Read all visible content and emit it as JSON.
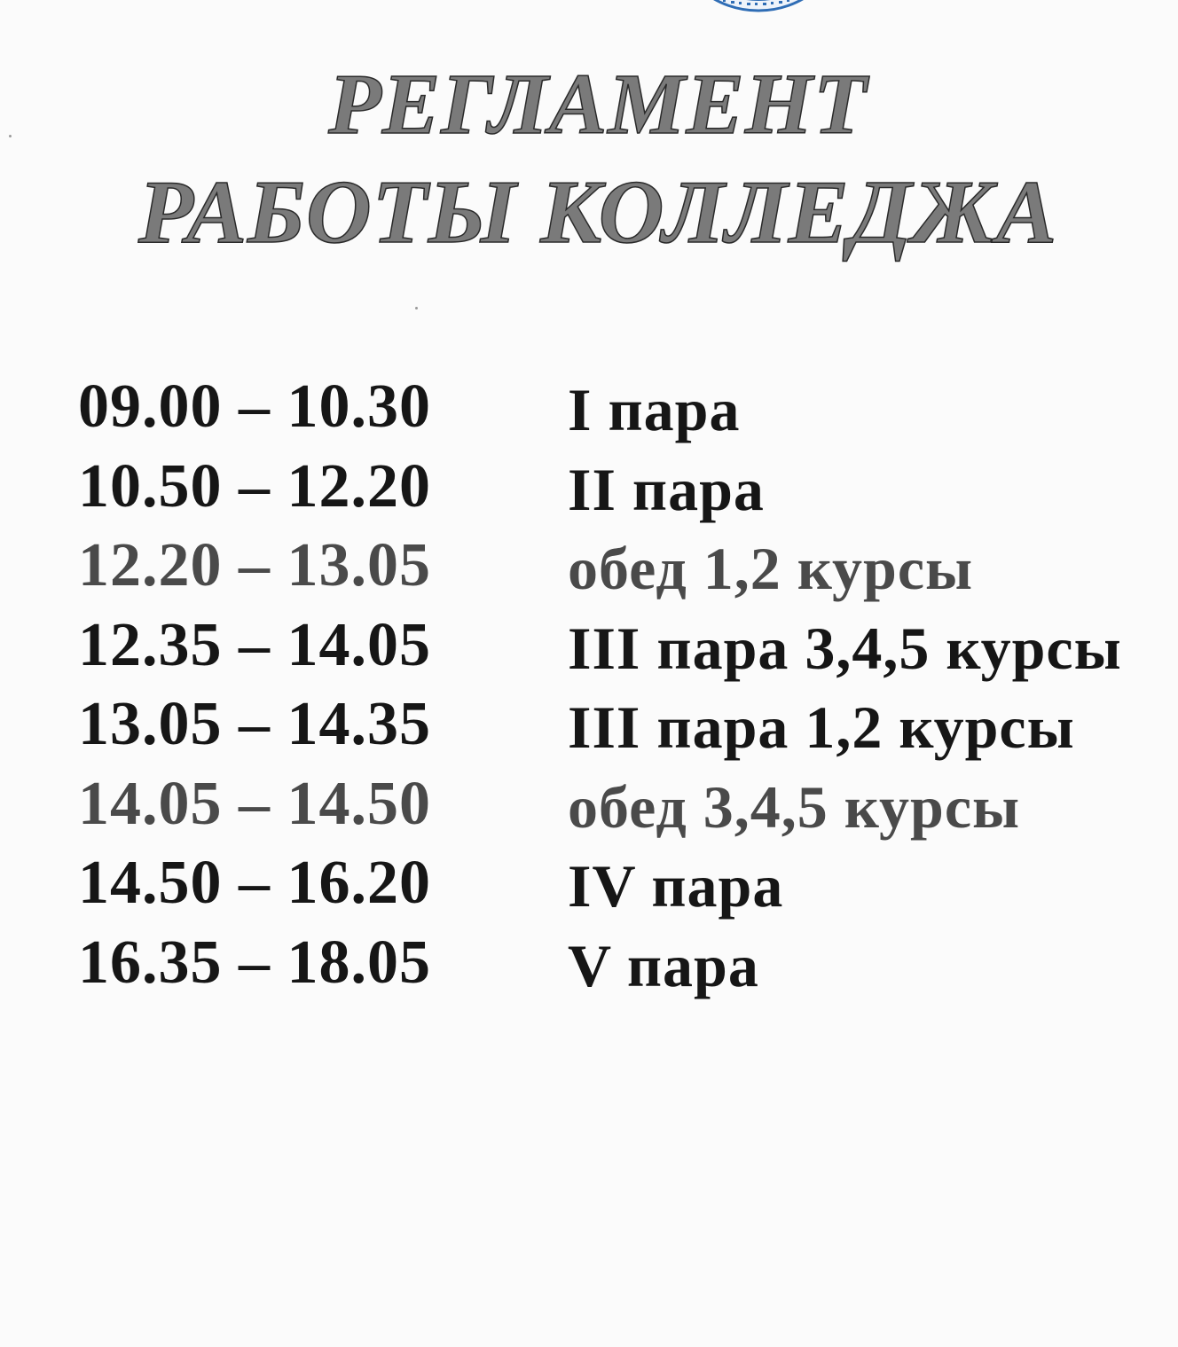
{
  "document": {
    "title_line1": "РЕГЛАМЕНТ",
    "title_line2": "РАБОТЫ КОЛЛЕДЖА",
    "seal_color": "#2f6db5"
  },
  "schedule": [
    {
      "time": "09.00 – 10.30",
      "label": "I пара"
    },
    {
      "time": "10.50 – 12.20",
      "label": "II пара"
    },
    {
      "time": "12.20 – 13.05",
      "label": "обед 1,2 курсы"
    },
    {
      "time": "12.35 – 14.05",
      "label": "III пара 3,4,5 курсы"
    },
    {
      "time": "13.05 – 14.35",
      "label": "III пара 1,2 курсы"
    },
    {
      "time": "14.05 – 14.50",
      "label": "обед 3,4,5 курсы"
    },
    {
      "time": "14.50 – 16.20",
      "label": "IV пара"
    },
    {
      "time": "16.35 – 18.05",
      "label": "V пара"
    }
  ]
}
